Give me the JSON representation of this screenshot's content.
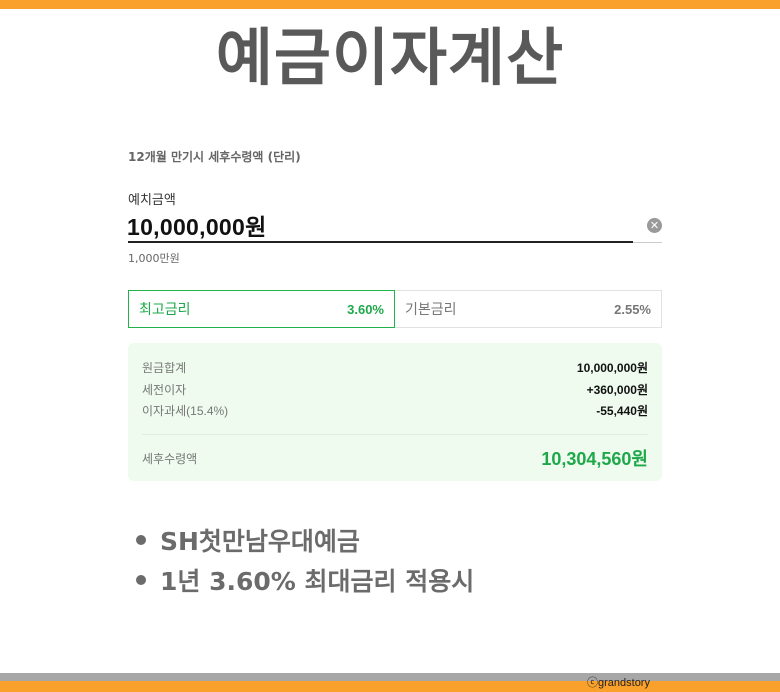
{
  "colors": {
    "accent": "#f9a12b",
    "green": "#1ea84a",
    "result_bg": "#eefbee"
  },
  "title": "예금이자계산",
  "subtitle": "12개월 만기시 세후수령액 (단리)",
  "deposit": {
    "label": "예치금액",
    "value": "10,000,000원",
    "hint": "1,000만원",
    "clear_icon": "close-circle-icon"
  },
  "rates": {
    "max": {
      "label": "최고금리",
      "value": "3.60%"
    },
    "base": {
      "label": "기본금리",
      "value": "2.55%"
    }
  },
  "result": {
    "principal": {
      "label": "원금합계",
      "value": "10,000,000원"
    },
    "pretax_interest": {
      "label": "세전이자",
      "value": "+360,000원"
    },
    "tax": {
      "label": "이자과세(15.4%)",
      "value": "-55,440원"
    },
    "net": {
      "label": "세후수령액",
      "value": "10,304,560원"
    }
  },
  "bullets": [
    "SH첫만남우대예금",
    "1년 3.60% 최대금리 적용시"
  ],
  "credit": "ⓒgrandstory"
}
